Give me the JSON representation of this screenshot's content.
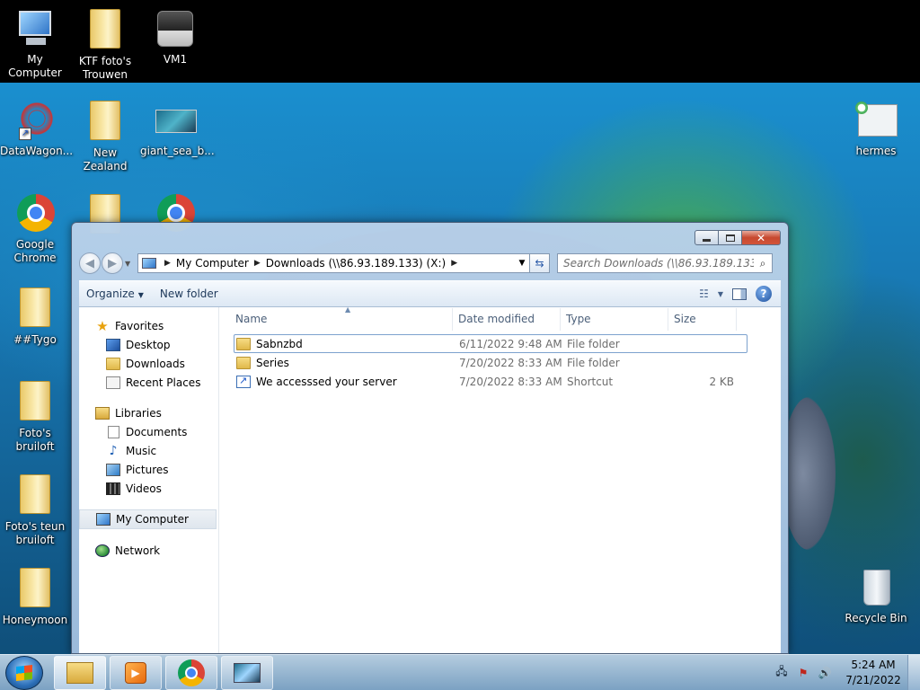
{
  "desktop": {
    "icons": [
      {
        "label": "My Computer",
        "icon": "computer-icon"
      },
      {
        "label": "KTF foto's Trouwen",
        "icon": "folder-icon"
      },
      {
        "label": "VM1",
        "icon": "vm-icon"
      },
      {
        "label": "DataWagon...",
        "icon": "datawagon-shortcut-icon"
      },
      {
        "label": "New Zealand",
        "icon": "folder-icon"
      },
      {
        "label": "giant_sea_b...",
        "icon": "image-file-icon"
      },
      {
        "label": "hermes",
        "icon": "hermes-icon"
      },
      {
        "label": "Google Chrome",
        "icon": "chrome-icon"
      },
      {
        "label": "##Tygo",
        "icon": "folder-icon"
      },
      {
        "label": "Foto's bruiloft",
        "icon": "folder-icon"
      },
      {
        "label": "Foto's teun bruiloft",
        "icon": "folder-icon"
      },
      {
        "label": "Honeymoon",
        "icon": "folder-icon"
      },
      {
        "label": "Recycle Bin",
        "icon": "recycle-bin-icon"
      }
    ]
  },
  "explorer": {
    "address": {
      "segments": [
        "My Computer",
        "Downloads (\\\\86.93.189.133) (X:)"
      ]
    },
    "search": {
      "placeholder": "Search Downloads (\\\\86.93.189.133) (X:)"
    },
    "toolbar": {
      "organize_label": "Organize",
      "new_folder_label": "New folder"
    },
    "navpane": {
      "favorites_label": "Favorites",
      "favorites": [
        "Desktop",
        "Downloads",
        "Recent Places"
      ],
      "libraries_label": "Libraries",
      "libraries": [
        "Documents",
        "Music",
        "Pictures",
        "Videos"
      ],
      "computer_label": "My Computer",
      "network_label": "Network"
    },
    "columns": {
      "name": "Name",
      "date": "Date modified",
      "type": "Type",
      "size": "Size"
    },
    "files": [
      {
        "name": "Sabnzbd",
        "date": "6/11/2022 9:48 AM",
        "type": "File folder",
        "size": "",
        "icon": "folder-icon"
      },
      {
        "name": "Series",
        "date": "7/20/2022 8:33 AM",
        "type": "File folder",
        "size": "",
        "icon": "folder-icon"
      },
      {
        "name": "We accesssed your server",
        "date": "7/20/2022 8:33 AM",
        "type": "Shortcut",
        "size": "2 KB",
        "icon": "shortcut-icon"
      }
    ]
  },
  "taskbar": {
    "apps": [
      "windows-explorer",
      "media-player",
      "google-chrome",
      "image-viewer"
    ],
    "clock": {
      "time": "5:24 AM",
      "date": "7/21/2022"
    }
  },
  "colors": {
    "window_frame": "#b9d1ea",
    "close_button": "#c7492f",
    "selection_border": "#7da2ce"
  }
}
